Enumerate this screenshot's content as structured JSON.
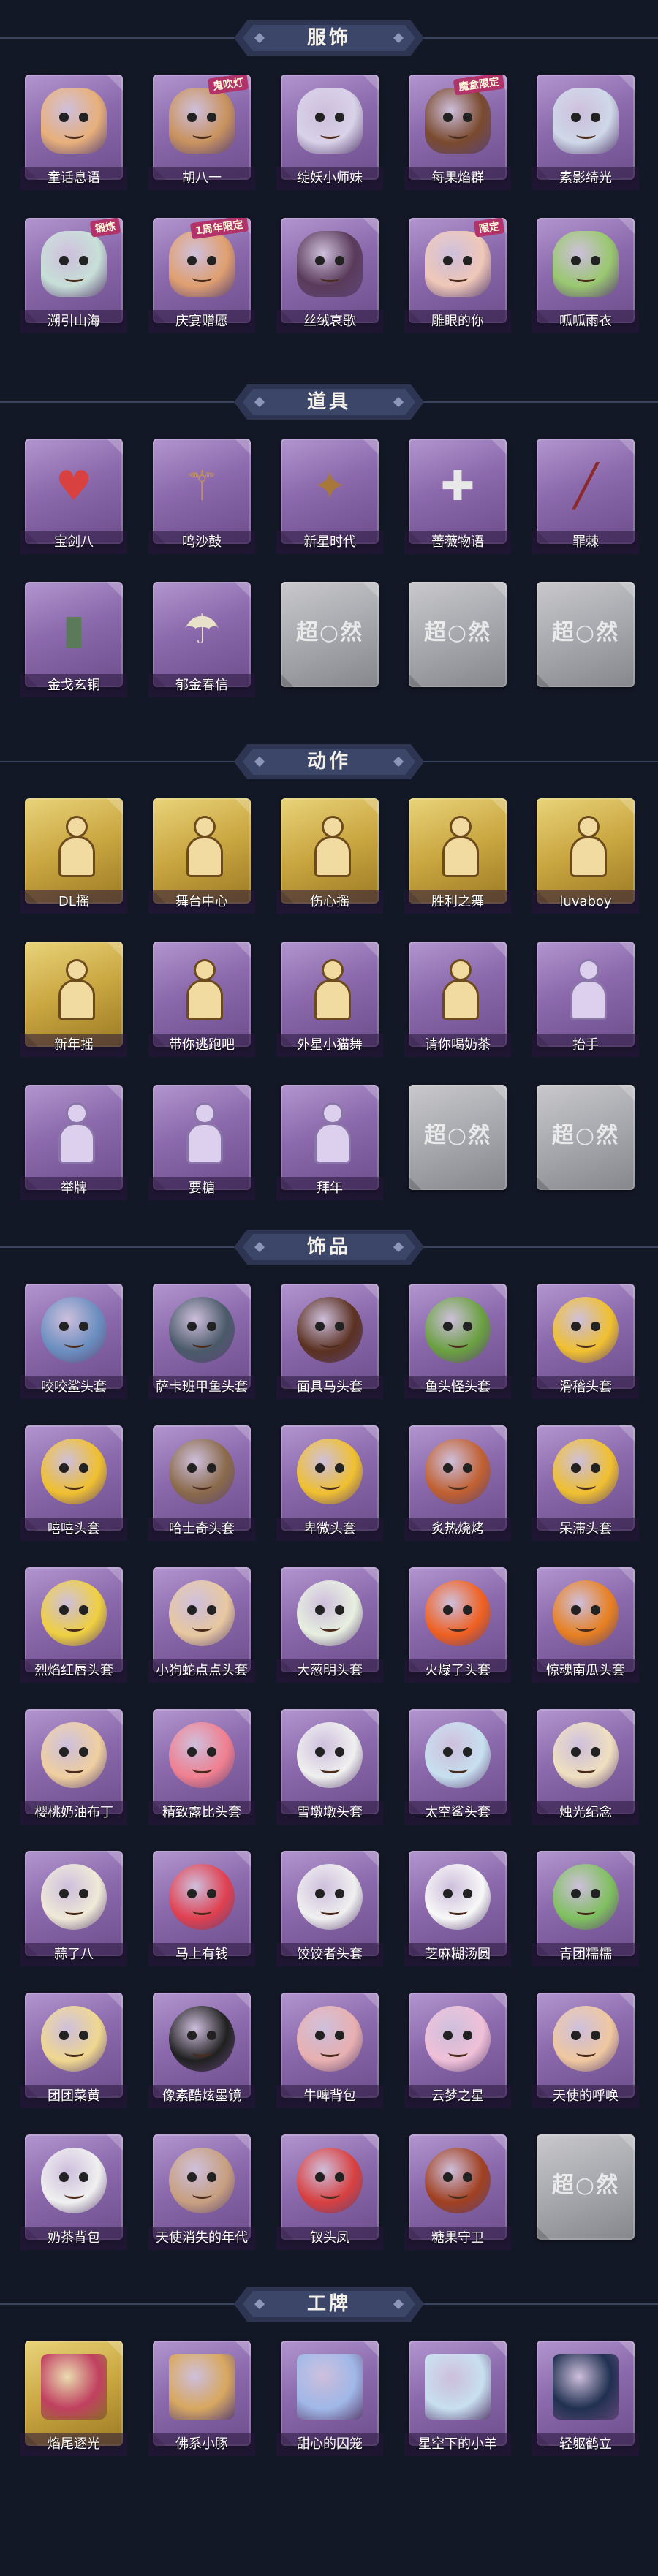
{
  "sections": [
    {
      "title": "服饰",
      "items": [
        {
          "label": "童话息语",
          "kind": "portrait",
          "color": "#e8b07a"
        },
        {
          "label": "胡八一",
          "kind": "portrait",
          "color": "#c9935e",
          "badge": "鬼吹灯"
        },
        {
          "label": "绽妖小师妹",
          "kind": "portrait",
          "color": "#d8d2e8"
        },
        {
          "label": "每果焰群",
          "kind": "portrait",
          "color": "#7a4a2e",
          "badge": "魔盒限定"
        },
        {
          "label": "素影绮光",
          "kind": "portrait",
          "color": "#cfd8e8"
        },
        {
          "label": "溯引山海",
          "kind": "portrait",
          "color": "#c8e0d8",
          "badge": "锻炼"
        },
        {
          "label": "庆宴赠愿",
          "kind": "portrait",
          "color": "#e0a070",
          "badge": "1周年限定"
        },
        {
          "label": "丝绒哀歌",
          "kind": "portrait",
          "color": "#5a3a5a"
        },
        {
          "label": "雕眼的你",
          "kind": "portrait",
          "color": "#f0c8b8",
          "badge": "限定"
        },
        {
          "label": "呱呱雨衣",
          "kind": "portrait",
          "color": "#9ac870"
        }
      ]
    },
    {
      "title": "道具",
      "items": [
        {
          "label": "宝剑八",
          "kind": "item",
          "icon": "heart-mirror-icon",
          "glyph": "♥",
          "color": "#d94040"
        },
        {
          "label": "鸣沙鼓",
          "kind": "item",
          "icon": "mallet-icon",
          "glyph": "⚚",
          "color": "#c0935a"
        },
        {
          "label": "新星时代",
          "kind": "item",
          "icon": "revolver-icon",
          "glyph": "✦",
          "color": "#a8783a"
        },
        {
          "label": "蔷薇物语",
          "kind": "item",
          "icon": "medkit-icon",
          "glyph": "✚",
          "color": "#e8e8e8"
        },
        {
          "label": "罪棘",
          "kind": "item",
          "icon": "spear-icon",
          "glyph": "╱",
          "color": "#8a2a2a"
        },
        {
          "label": "金戈玄铜",
          "kind": "item",
          "icon": "lantern-icon",
          "glyph": "▮",
          "color": "#5a7a5a"
        },
        {
          "label": "郁金春信",
          "kind": "item",
          "icon": "umbrella-icon",
          "glyph": "☂",
          "color": "#e8e0c8"
        },
        {
          "label": "",
          "kind": "locked",
          "lockText": "超○然"
        },
        {
          "label": "",
          "kind": "locked",
          "lockText": "超○然"
        },
        {
          "label": "",
          "kind": "locked",
          "lockText": "超○然"
        }
      ]
    },
    {
      "title": "动作",
      "items": [
        {
          "label": "DL摇",
          "kind": "pose",
          "gold": true
        },
        {
          "label": "舞台中心",
          "kind": "pose",
          "gold": true
        },
        {
          "label": "伤心摇",
          "kind": "pose",
          "gold": true
        },
        {
          "label": "胜利之舞",
          "kind": "pose",
          "gold": true
        },
        {
          "label": "luvaboy",
          "kind": "pose",
          "gold": true
        },
        {
          "label": "新年摇",
          "kind": "pose",
          "gold": true
        },
        {
          "label": "带你逃跑吧",
          "kind": "pose"
        },
        {
          "label": "外星小猫舞",
          "kind": "pose"
        },
        {
          "label": "请你喝奶茶",
          "kind": "pose"
        },
        {
          "label": "抬手",
          "kind": "pose",
          "light": true
        },
        {
          "label": "举牌",
          "kind": "pose",
          "light": true
        },
        {
          "label": "要糖",
          "kind": "pose",
          "light": true
        },
        {
          "label": "拜年",
          "kind": "pose",
          "light": true
        },
        {
          "label": "",
          "kind": "locked",
          "lockText": "超○然"
        },
        {
          "label": "",
          "kind": "locked",
          "lockText": "超○然"
        }
      ]
    },
    {
      "title": "饰品",
      "items": [
        {
          "label": "咬咬鲨头套",
          "kind": "head",
          "color": "#6a8ec0"
        },
        {
          "label": "萨卡班甲鱼头套",
          "kind": "head",
          "color": "#4a5a6a"
        },
        {
          "label": "面具马头套",
          "kind": "head",
          "color": "#5a3020"
        },
        {
          "label": "鱼头怪头套",
          "kind": "head",
          "color": "#6aa040"
        },
        {
          "label": "滑稽头套",
          "kind": "head",
          "color": "#f0c030"
        },
        {
          "label": "嘻嘻头套",
          "kind": "head",
          "color": "#f0c030"
        },
        {
          "label": "哈士奇头套",
          "kind": "head",
          "color": "#8a6a4a"
        },
        {
          "label": "卑微头套",
          "kind": "head",
          "color": "#f0c030"
        },
        {
          "label": "炙热烧烤",
          "kind": "head",
          "color": "#c06030"
        },
        {
          "label": "呆滞头套",
          "kind": "head",
          "color": "#f0c030"
        },
        {
          "label": "烈焰红唇头套",
          "kind": "head",
          "color": "#f0d040"
        },
        {
          "label": "小狗蛇点点头套",
          "kind": "head",
          "color": "#e8c8a0"
        },
        {
          "label": "大葱明头套",
          "kind": "head",
          "color": "#e8f0e0"
        },
        {
          "label": "火爆了头套",
          "kind": "head",
          "color": "#f06020"
        },
        {
          "label": "惊魂南瓜头套",
          "kind": "head",
          "color": "#e88020"
        },
        {
          "label": "樱桃奶油布丁",
          "kind": "head",
          "color": "#f0d0a0"
        },
        {
          "label": "精致露比头套",
          "kind": "head",
          "color": "#f08090"
        },
        {
          "label": "雪墩墩头套",
          "kind": "head",
          "color": "#f0f0f0"
        },
        {
          "label": "太空鲨头套",
          "kind": "head",
          "color": "#c8e0f0"
        },
        {
          "label": "烛光纪念",
          "kind": "head",
          "color": "#f0e0c0"
        },
        {
          "label": "蒜了八",
          "kind": "head",
          "color": "#f0ead8"
        },
        {
          "label": "马上有钱",
          "kind": "head",
          "color": "#e04050"
        },
        {
          "label": "饺饺者头套",
          "kind": "head",
          "color": "#f0f0f0"
        },
        {
          "label": "芝麻糊汤圆",
          "kind": "head",
          "color": "#f8f8f8"
        },
        {
          "label": "青团糯糯",
          "kind": "head",
          "color": "#80c060"
        },
        {
          "label": "团团菜黄",
          "kind": "head",
          "color": "#f0d890"
        },
        {
          "label": "像素酷炫墨镜",
          "kind": "head",
          "color": "#202020"
        },
        {
          "label": "牛啤背包",
          "kind": "head",
          "color": "#e8b0b0"
        },
        {
          "label": "云梦之星",
          "kind": "head",
          "color": "#f0c0d8"
        },
        {
          "label": "天使的呼唤",
          "kind": "head",
          "color": "#f0c8a0"
        },
        {
          "label": "奶茶背包",
          "kind": "head",
          "color": "#f0f0f0"
        },
        {
          "label": "天使消失的年代",
          "kind": "head",
          "color": "#c8a080"
        },
        {
          "label": "钗头凤",
          "kind": "head",
          "color": "#d84040"
        },
        {
          "label": "糖果守卫",
          "kind": "head",
          "color": "#a04020"
        },
        {
          "label": "",
          "kind": "locked",
          "lockText": "超○然"
        }
      ]
    },
    {
      "title": "工牌",
      "items": [
        {
          "label": "焰尾逐光",
          "kind": "card",
          "color": "#c04060",
          "gold": true
        },
        {
          "label": "佛系小豚",
          "kind": "card",
          "color": "#d8a860"
        },
        {
          "label": "甜心的囚笼",
          "kind": "card",
          "color": "#a0b8e8"
        },
        {
          "label": "星空下的小羊",
          "kind": "card",
          "color": "#c8e0f0"
        },
        {
          "label": "轻躯鹤立",
          "kind": "card",
          "color": "#203050"
        }
      ]
    }
  ]
}
